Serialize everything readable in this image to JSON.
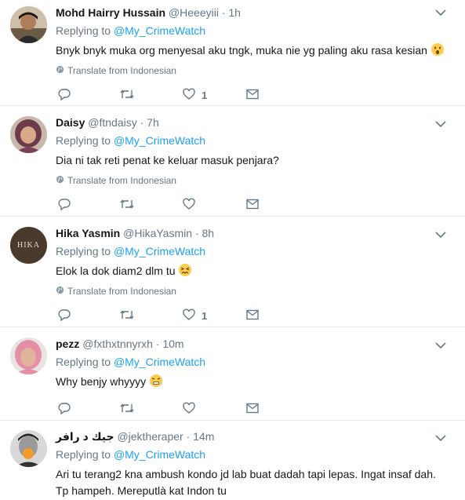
{
  "tweets": [
    {
      "name": "Mohd Hairry Hussain",
      "handle": "@Heeeyiii",
      "time": "· 1h",
      "replying_label": "Replying to",
      "replying_to": "@My_CrimeWatch",
      "text": "Bnyk bnyk muka org menyesal aku tngk, muka nie yg paling aku rasa kesian",
      "emoji": "hushed-face",
      "translate": "Translate from Indonesian",
      "likes": "1"
    },
    {
      "name": "Daisy",
      "handle": "@ftndaisy",
      "time": "· 7h",
      "replying_label": "Replying to",
      "replying_to": "@My_CrimeWatch",
      "text": "Dia ni tak reti penat ke keluar masuk penjara?",
      "translate": "Translate from Indonesian",
      "likes": ""
    },
    {
      "name": "Hika Yasmin",
      "handle": "@HikaYasmin",
      "time": "· 8h",
      "avatar_text": "HIKA",
      "replying_label": "Replying to",
      "replying_to": "@My_CrimeWatch",
      "text": "Elok la dok diam2 dlm tu",
      "emoji": "confounded-face",
      "translate": "Translate from Indonesian",
      "likes": "1"
    },
    {
      "name": "pezz",
      "handle": "@fxthxtnnyrxh",
      "time": "· 10m",
      "replying_label": "Replying to",
      "replying_to": "@My_CrimeWatch",
      "text": "Why benjy whyyyy",
      "emoji": "steam-face",
      "likes": ""
    },
    {
      "name": "جيك د رافر",
      "handle": "@jektheraper",
      "time": "· 14m",
      "replying_label": "Replying to",
      "replying_to": "@My_CrimeWatch",
      "text_line1": "Ari tu terang2 kna ambush kondo jd lab buat dadah tapi lepas. Ingat insaf dah.",
      "text_line2": "Tp hampeh. Mereputlà kat Indon tu"
    }
  ],
  "colors": {
    "accent": "#1da1f2",
    "secondary_text": "#657786",
    "divider": "#e6ecf0"
  }
}
